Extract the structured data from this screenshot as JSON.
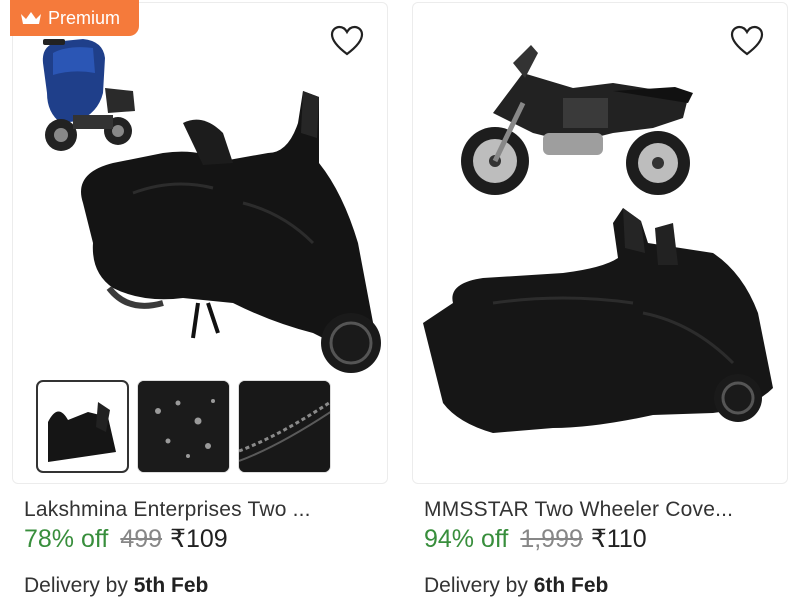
{
  "products": [
    {
      "badge": "Premium",
      "title": "Lakshmina Enterprises Two ...",
      "discount": "78% off",
      "mrp": "499",
      "price": "₹109",
      "delivery_prefix": "Delivery by ",
      "delivery_date": "5th Feb"
    },
    {
      "title": "MMSSTAR Two Wheeler Cove...",
      "discount": "94% off",
      "mrp": "1,999",
      "price": "₹110",
      "delivery_prefix": "Delivery by ",
      "delivery_date": "6th Feb"
    }
  ],
  "icons": {
    "wishlist": "heart-outline-icon",
    "badge": "crown-icon"
  },
  "colors": {
    "premium": "#f57a3b",
    "discount": "#388e3c",
    "mrp": "#878787"
  }
}
